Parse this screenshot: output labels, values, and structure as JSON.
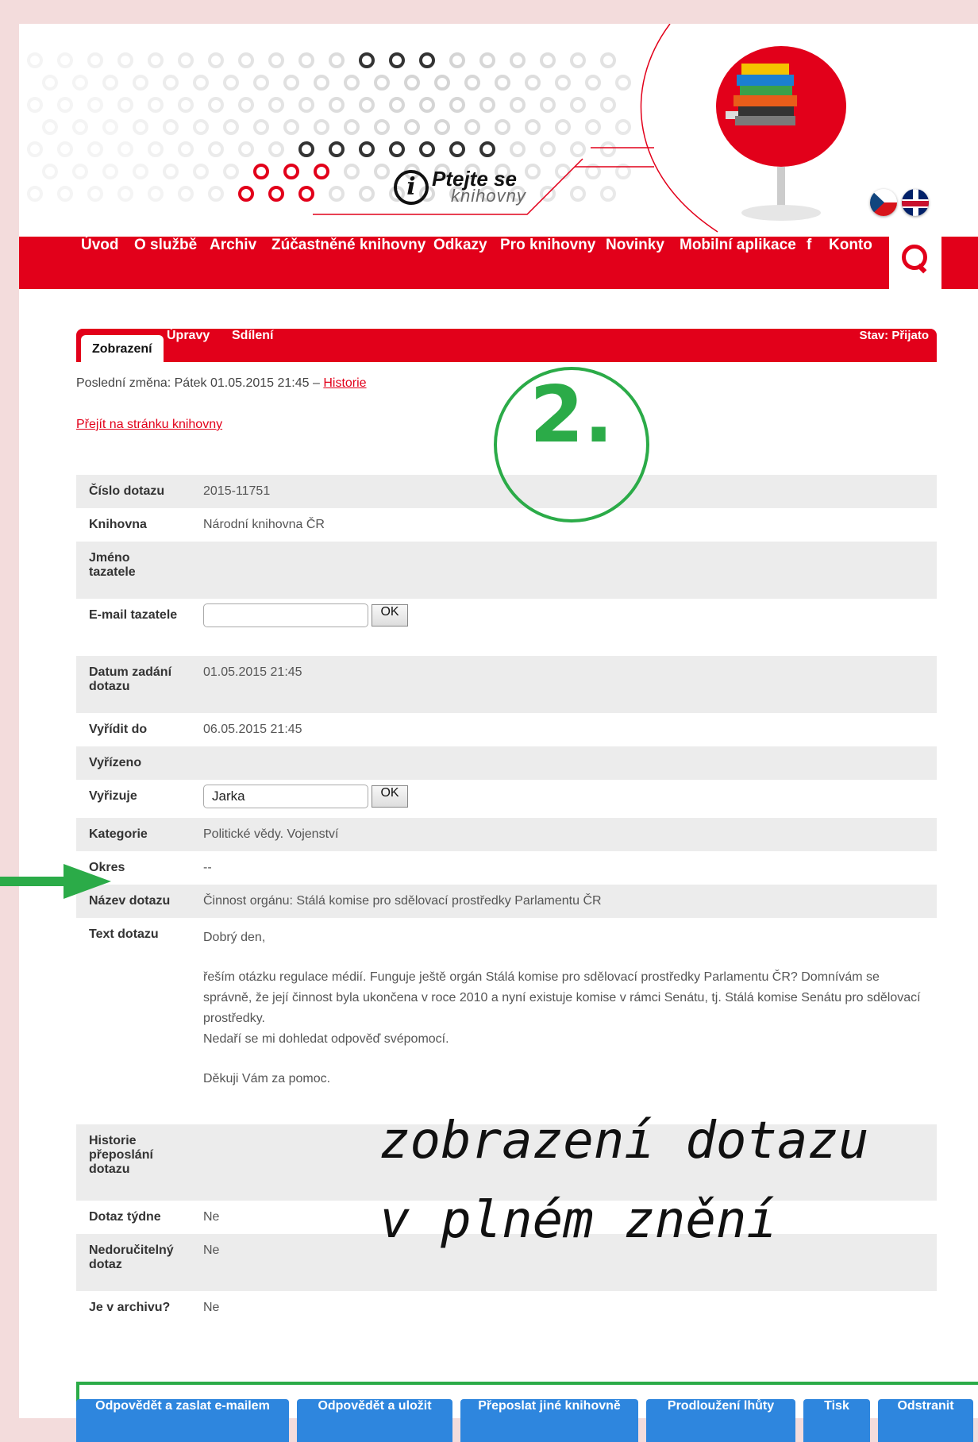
{
  "header": {
    "logo_line1": "Ptejte se",
    "logo_line2": "knihovny",
    "logo_i": "i"
  },
  "nav": {
    "items": [
      "Úvod",
      "O službě",
      "Archiv",
      "Zúčastněné knihovny",
      "Odkazy",
      "Pro knihovny",
      "Novinky",
      "Mobilní aplikace",
      "f",
      "Konto"
    ],
    "search_icon": "search-icon"
  },
  "tabs": {
    "items": [
      "Zobrazení",
      "Úpravy",
      "Sdílení"
    ],
    "status": "Stav: Přijato"
  },
  "meta": {
    "last_change": "Poslední změna: Pátek 01.05.2015 21:45 – ",
    "history_link": "Historie",
    "library_link": "Přejít na stránku knihovny"
  },
  "annotations": {
    "step_badge": "2.",
    "caption_line1": "zobrazení dotazu",
    "caption_line2": "v plném znění"
  },
  "detail": {
    "cislo_label": "Číslo dotazu",
    "cislo_value": "2015-11751",
    "knihovna_label": "Knihovna",
    "knihovna_value": "Národní knihovna ČR",
    "jmeno_label": "Jméno tazatele",
    "jmeno_value": "",
    "email_label": "E-mail tazatele",
    "email_value": "",
    "ok_label": "OK",
    "datum_label": "Datum zadání dotazu",
    "datum_value": "01.05.2015 21:45",
    "vyridit_label": "Vyřídit do",
    "vyridit_value": "06.05.2015 21:45",
    "vyrizeno_label": "Vyřízeno",
    "vyrizeno_value": "",
    "vyrizuje_label": "Vyřizuje",
    "vyrizuje_value": "Jarka",
    "kategorie_label": "Kategorie",
    "kategorie_value": "Politické vědy. Vojenství",
    "okres_label": "Okres",
    "okres_value": "--",
    "nazev_label": "Název dotazu",
    "nazev_value": "Činnost orgánu: Stálá komise pro sdělovací prostředky Parlamentu ČR",
    "text_label": "Text dotazu",
    "text_p1": "Dobrý den,",
    "text_p2a": "řeším otázku regulace médií. Funguje ještě orgán Stálá komise pro sdělovací prostředky Parlamentu ČR? Domnívám se správně, že její činnost byla ukončena v roce 2010 a nyní existuje komise v rámci Senátu, tj. Stálá komise Senátu pro sdělovací prostředky.",
    "text_p2b": "Nedaří se mi dohledat odpověď svépomocí.",
    "text_p3": "Děkuji Vám za pomoc.",
    "historie_label": "Historie přeposlání dotazu",
    "historie_value": "",
    "tydne_label": "Dotaz týdne",
    "tydne_value": "Ne",
    "nedoruc_label": "Nedoručitelný dotaz",
    "nedoruc_value": "Ne",
    "archiv_label": "Je v archivu?",
    "archiv_value": "Ne"
  },
  "actions": {
    "reply_email": "Odpovědět a zaslat e-mailem",
    "reply_save": "Odpovědět a uložit",
    "forward": "Přeposlat jiné knihovně",
    "extend": "Prodloužení lhůty",
    "print": "Tisk",
    "delete": "Odstranit"
  },
  "colors": {
    "brand_red": "#e2001a",
    "annotation_green": "#2bab48",
    "action_blue": "#2e86de"
  }
}
